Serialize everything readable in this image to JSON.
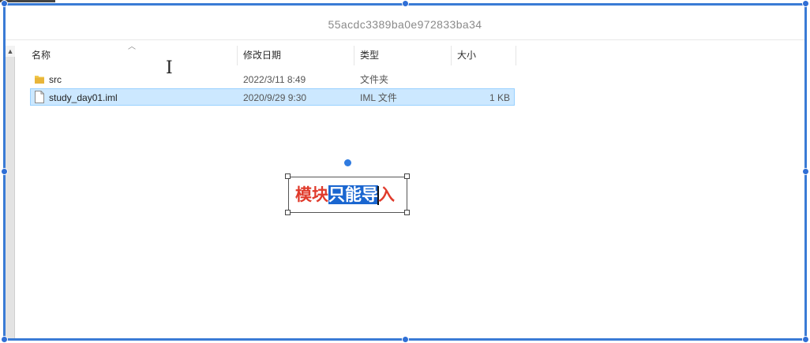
{
  "window": {
    "title": "55acdc3389ba0e972833ba34"
  },
  "columns": {
    "name": "名称",
    "modified": "修改日期",
    "type": "类型",
    "size": "大小"
  },
  "files": [
    {
      "name": "src",
      "modified": "2022/3/11 8:49",
      "type": "文件夹",
      "size": "",
      "kind": "folder-icon",
      "selected": false
    },
    {
      "name": "study_day01.iml",
      "modified": "2020/9/29 9:30",
      "type": "IML 文件",
      "size": "1 KB",
      "kind": "file-icon",
      "selected": true
    }
  ],
  "annotation": {
    "prefix": "模块",
    "highlighted": "只能导",
    "suffix": "入",
    "text_color": "#e03b2c",
    "highlight_color": "#1a66d0"
  },
  "colors": {
    "selection_bg": "#cce8ff",
    "frame": "#3a7bd5"
  }
}
